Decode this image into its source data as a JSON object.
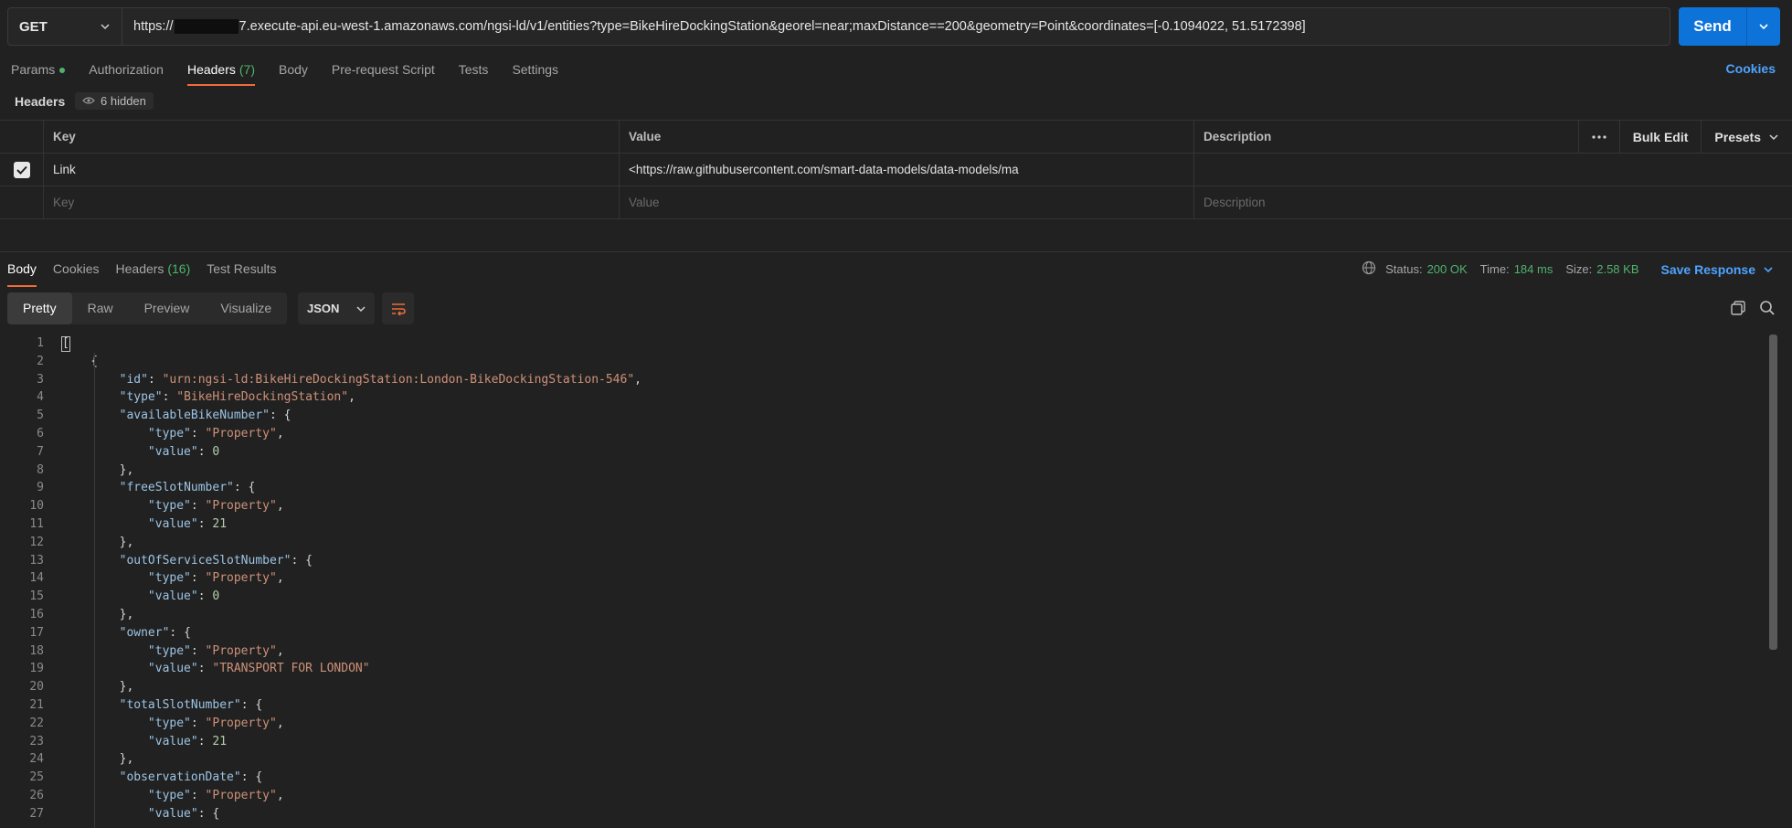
{
  "request": {
    "method": "GET",
    "url_prefix": "https://",
    "url_suffix": "7.execute-api.eu-west-1.amazonaws.com/ngsi-ld/v1/entities?type=BikeHireDockingStation&georel=near;maxDistance==200&geometry=Point&coordinates=[-0.1094022, 51.5172398]",
    "send_label": "Send"
  },
  "req_tabs": [
    {
      "label": "Params",
      "count": ""
    },
    {
      "label": "Authorization",
      "count": ""
    },
    {
      "label": "Headers",
      "count": "(7)"
    },
    {
      "label": "Body",
      "count": ""
    },
    {
      "label": "Pre-request Script",
      "count": ""
    },
    {
      "label": "Tests",
      "count": ""
    },
    {
      "label": "Settings",
      "count": ""
    }
  ],
  "cookies_label": "Cookies",
  "headers_section": {
    "title": "Headers",
    "hidden_label": "6 hidden",
    "col_key": "Key",
    "col_value": "Value",
    "col_description": "Description",
    "bulk_edit": "Bulk Edit",
    "presets": "Presets",
    "rows": [
      {
        "key": "Link",
        "value": "<https://raw.githubusercontent.com/smart-data-models/data-models/ma",
        "description": ""
      }
    ],
    "placeholder_key": "Key",
    "placeholder_value": "Value",
    "placeholder_description": "Description"
  },
  "resp_tabs": [
    {
      "label": "Body",
      "count": ""
    },
    {
      "label": "Cookies",
      "count": ""
    },
    {
      "label": "Headers ",
      "count": "(16)"
    },
    {
      "label": "Test Results",
      "count": ""
    }
  ],
  "status": {
    "status_label": "Status:",
    "status_value": "200 OK",
    "time_label": "Time:",
    "time_value": "184 ms",
    "size_label": "Size:",
    "size_value": "2.58 KB",
    "save_label": "Save Response"
  },
  "view_modes": [
    "Pretty",
    "Raw",
    "Preview",
    "Visualize"
  ],
  "format": "JSON",
  "code_lines": [
    [
      [
        "p",
        "["
      ]
    ],
    [
      [
        "p",
        "    {"
      ]
    ],
    [
      [
        "p",
        "        "
      ],
      [
        "k",
        "\"id\""
      ],
      [
        "p",
        ": "
      ],
      [
        "s",
        "\"urn:ngsi-ld:BikeHireDockingStation:London-BikeDockingStation-546\""
      ],
      [
        "p",
        ","
      ]
    ],
    [
      [
        "p",
        "        "
      ],
      [
        "k",
        "\"type\""
      ],
      [
        "p",
        ": "
      ],
      [
        "s",
        "\"BikeHireDockingStation\""
      ],
      [
        "p",
        ","
      ]
    ],
    [
      [
        "p",
        "        "
      ],
      [
        "k",
        "\"availableBikeNumber\""
      ],
      [
        "p",
        ": {"
      ]
    ],
    [
      [
        "p",
        "            "
      ],
      [
        "k",
        "\"type\""
      ],
      [
        "p",
        ": "
      ],
      [
        "s",
        "\"Property\""
      ],
      [
        "p",
        ","
      ]
    ],
    [
      [
        "p",
        "            "
      ],
      [
        "k",
        "\"value\""
      ],
      [
        "p",
        ": "
      ],
      [
        "n",
        "0"
      ]
    ],
    [
      [
        "p",
        "        },"
      ]
    ],
    [
      [
        "p",
        "        "
      ],
      [
        "k",
        "\"freeSlotNumber\""
      ],
      [
        "p",
        ": {"
      ]
    ],
    [
      [
        "p",
        "            "
      ],
      [
        "k",
        "\"type\""
      ],
      [
        "p",
        ": "
      ],
      [
        "s",
        "\"Property\""
      ],
      [
        "p",
        ","
      ]
    ],
    [
      [
        "p",
        "            "
      ],
      [
        "k",
        "\"value\""
      ],
      [
        "p",
        ": "
      ],
      [
        "n",
        "21"
      ]
    ],
    [
      [
        "p",
        "        },"
      ]
    ],
    [
      [
        "p",
        "        "
      ],
      [
        "k",
        "\"outOfServiceSlotNumber\""
      ],
      [
        "p",
        ": {"
      ]
    ],
    [
      [
        "p",
        "            "
      ],
      [
        "k",
        "\"type\""
      ],
      [
        "p",
        ": "
      ],
      [
        "s",
        "\"Property\""
      ],
      [
        "p",
        ","
      ]
    ],
    [
      [
        "p",
        "            "
      ],
      [
        "k",
        "\"value\""
      ],
      [
        "p",
        ": "
      ],
      [
        "n",
        "0"
      ]
    ],
    [
      [
        "p",
        "        },"
      ]
    ],
    [
      [
        "p",
        "        "
      ],
      [
        "k",
        "\"owner\""
      ],
      [
        "p",
        ": {"
      ]
    ],
    [
      [
        "p",
        "            "
      ],
      [
        "k",
        "\"type\""
      ],
      [
        "p",
        ": "
      ],
      [
        "s",
        "\"Property\""
      ],
      [
        "p",
        ","
      ]
    ],
    [
      [
        "p",
        "            "
      ],
      [
        "k",
        "\"value\""
      ],
      [
        "p",
        ": "
      ],
      [
        "s",
        "\"TRANSPORT FOR LONDON\""
      ]
    ],
    [
      [
        "p",
        "        },"
      ]
    ],
    [
      [
        "p",
        "        "
      ],
      [
        "k",
        "\"totalSlotNumber\""
      ],
      [
        "p",
        ": {"
      ]
    ],
    [
      [
        "p",
        "            "
      ],
      [
        "k",
        "\"type\""
      ],
      [
        "p",
        ": "
      ],
      [
        "s",
        "\"Property\""
      ],
      [
        "p",
        ","
      ]
    ],
    [
      [
        "p",
        "            "
      ],
      [
        "k",
        "\"value\""
      ],
      [
        "p",
        ": "
      ],
      [
        "n",
        "21"
      ]
    ],
    [
      [
        "p",
        "        },"
      ]
    ],
    [
      [
        "p",
        "        "
      ],
      [
        "k",
        "\"observationDate\""
      ],
      [
        "p",
        ": {"
      ]
    ],
    [
      [
        "p",
        "            "
      ],
      [
        "k",
        "\"type\""
      ],
      [
        "p",
        ": "
      ],
      [
        "s",
        "\"Property\""
      ],
      [
        "p",
        ","
      ]
    ],
    [
      [
        "p",
        "            "
      ],
      [
        "k",
        "\"value\""
      ],
      [
        "p",
        ": {"
      ]
    ]
  ],
  "colors": {
    "accent": "#f26b3a",
    "send": "#0d73d9",
    "link": "#4fa3ff",
    "success": "#4fb36d"
  }
}
